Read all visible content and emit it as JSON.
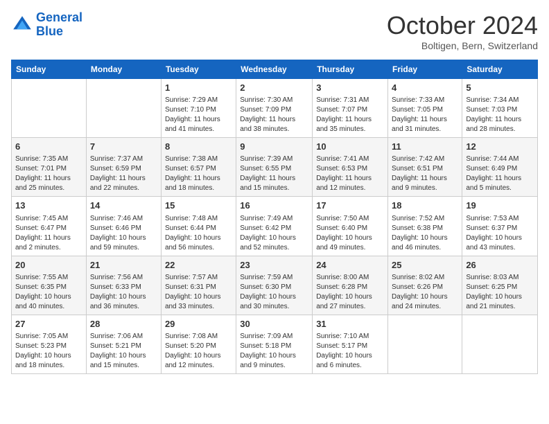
{
  "header": {
    "logo_line1": "General",
    "logo_line2": "Blue",
    "month_title": "October 2024",
    "location": "Boltigen, Bern, Switzerland"
  },
  "days_of_week": [
    "Sunday",
    "Monday",
    "Tuesday",
    "Wednesday",
    "Thursday",
    "Friday",
    "Saturday"
  ],
  "weeks": [
    [
      {
        "day": "",
        "sunrise": "",
        "sunset": "",
        "daylight": ""
      },
      {
        "day": "",
        "sunrise": "",
        "sunset": "",
        "daylight": ""
      },
      {
        "day": "1",
        "sunrise": "Sunrise: 7:29 AM",
        "sunset": "Sunset: 7:10 PM",
        "daylight": "Daylight: 11 hours and 41 minutes."
      },
      {
        "day": "2",
        "sunrise": "Sunrise: 7:30 AM",
        "sunset": "Sunset: 7:09 PM",
        "daylight": "Daylight: 11 hours and 38 minutes."
      },
      {
        "day": "3",
        "sunrise": "Sunrise: 7:31 AM",
        "sunset": "Sunset: 7:07 PM",
        "daylight": "Daylight: 11 hours and 35 minutes."
      },
      {
        "day": "4",
        "sunrise": "Sunrise: 7:33 AM",
        "sunset": "Sunset: 7:05 PM",
        "daylight": "Daylight: 11 hours and 31 minutes."
      },
      {
        "day": "5",
        "sunrise": "Sunrise: 7:34 AM",
        "sunset": "Sunset: 7:03 PM",
        "daylight": "Daylight: 11 hours and 28 minutes."
      }
    ],
    [
      {
        "day": "6",
        "sunrise": "Sunrise: 7:35 AM",
        "sunset": "Sunset: 7:01 PM",
        "daylight": "Daylight: 11 hours and 25 minutes."
      },
      {
        "day": "7",
        "sunrise": "Sunrise: 7:37 AM",
        "sunset": "Sunset: 6:59 PM",
        "daylight": "Daylight: 11 hours and 22 minutes."
      },
      {
        "day": "8",
        "sunrise": "Sunrise: 7:38 AM",
        "sunset": "Sunset: 6:57 PM",
        "daylight": "Daylight: 11 hours and 18 minutes."
      },
      {
        "day": "9",
        "sunrise": "Sunrise: 7:39 AM",
        "sunset": "Sunset: 6:55 PM",
        "daylight": "Daylight: 11 hours and 15 minutes."
      },
      {
        "day": "10",
        "sunrise": "Sunrise: 7:41 AM",
        "sunset": "Sunset: 6:53 PM",
        "daylight": "Daylight: 11 hours and 12 minutes."
      },
      {
        "day": "11",
        "sunrise": "Sunrise: 7:42 AM",
        "sunset": "Sunset: 6:51 PM",
        "daylight": "Daylight: 11 hours and 9 minutes."
      },
      {
        "day": "12",
        "sunrise": "Sunrise: 7:44 AM",
        "sunset": "Sunset: 6:49 PM",
        "daylight": "Daylight: 11 hours and 5 minutes."
      }
    ],
    [
      {
        "day": "13",
        "sunrise": "Sunrise: 7:45 AM",
        "sunset": "Sunset: 6:47 PM",
        "daylight": "Daylight: 11 hours and 2 minutes."
      },
      {
        "day": "14",
        "sunrise": "Sunrise: 7:46 AM",
        "sunset": "Sunset: 6:46 PM",
        "daylight": "Daylight: 10 hours and 59 minutes."
      },
      {
        "day": "15",
        "sunrise": "Sunrise: 7:48 AM",
        "sunset": "Sunset: 6:44 PM",
        "daylight": "Daylight: 10 hours and 56 minutes."
      },
      {
        "day": "16",
        "sunrise": "Sunrise: 7:49 AM",
        "sunset": "Sunset: 6:42 PM",
        "daylight": "Daylight: 10 hours and 52 minutes."
      },
      {
        "day": "17",
        "sunrise": "Sunrise: 7:50 AM",
        "sunset": "Sunset: 6:40 PM",
        "daylight": "Daylight: 10 hours and 49 minutes."
      },
      {
        "day": "18",
        "sunrise": "Sunrise: 7:52 AM",
        "sunset": "Sunset: 6:38 PM",
        "daylight": "Daylight: 10 hours and 46 minutes."
      },
      {
        "day": "19",
        "sunrise": "Sunrise: 7:53 AM",
        "sunset": "Sunset: 6:37 PM",
        "daylight": "Daylight: 10 hours and 43 minutes."
      }
    ],
    [
      {
        "day": "20",
        "sunrise": "Sunrise: 7:55 AM",
        "sunset": "Sunset: 6:35 PM",
        "daylight": "Daylight: 10 hours and 40 minutes."
      },
      {
        "day": "21",
        "sunrise": "Sunrise: 7:56 AM",
        "sunset": "Sunset: 6:33 PM",
        "daylight": "Daylight: 10 hours and 36 minutes."
      },
      {
        "day": "22",
        "sunrise": "Sunrise: 7:57 AM",
        "sunset": "Sunset: 6:31 PM",
        "daylight": "Daylight: 10 hours and 33 minutes."
      },
      {
        "day": "23",
        "sunrise": "Sunrise: 7:59 AM",
        "sunset": "Sunset: 6:30 PM",
        "daylight": "Daylight: 10 hours and 30 minutes."
      },
      {
        "day": "24",
        "sunrise": "Sunrise: 8:00 AM",
        "sunset": "Sunset: 6:28 PM",
        "daylight": "Daylight: 10 hours and 27 minutes."
      },
      {
        "day": "25",
        "sunrise": "Sunrise: 8:02 AM",
        "sunset": "Sunset: 6:26 PM",
        "daylight": "Daylight: 10 hours and 24 minutes."
      },
      {
        "day": "26",
        "sunrise": "Sunrise: 8:03 AM",
        "sunset": "Sunset: 6:25 PM",
        "daylight": "Daylight: 10 hours and 21 minutes."
      }
    ],
    [
      {
        "day": "27",
        "sunrise": "Sunrise: 7:05 AM",
        "sunset": "Sunset: 5:23 PM",
        "daylight": "Daylight: 10 hours and 18 minutes."
      },
      {
        "day": "28",
        "sunrise": "Sunrise: 7:06 AM",
        "sunset": "Sunset: 5:21 PM",
        "daylight": "Daylight: 10 hours and 15 minutes."
      },
      {
        "day": "29",
        "sunrise": "Sunrise: 7:08 AM",
        "sunset": "Sunset: 5:20 PM",
        "daylight": "Daylight: 10 hours and 12 minutes."
      },
      {
        "day": "30",
        "sunrise": "Sunrise: 7:09 AM",
        "sunset": "Sunset: 5:18 PM",
        "daylight": "Daylight: 10 hours and 9 minutes."
      },
      {
        "day": "31",
        "sunrise": "Sunrise: 7:10 AM",
        "sunset": "Sunset: 5:17 PM",
        "daylight": "Daylight: 10 hours and 6 minutes."
      },
      {
        "day": "",
        "sunrise": "",
        "sunset": "",
        "daylight": ""
      },
      {
        "day": "",
        "sunrise": "",
        "sunset": "",
        "daylight": ""
      }
    ]
  ]
}
